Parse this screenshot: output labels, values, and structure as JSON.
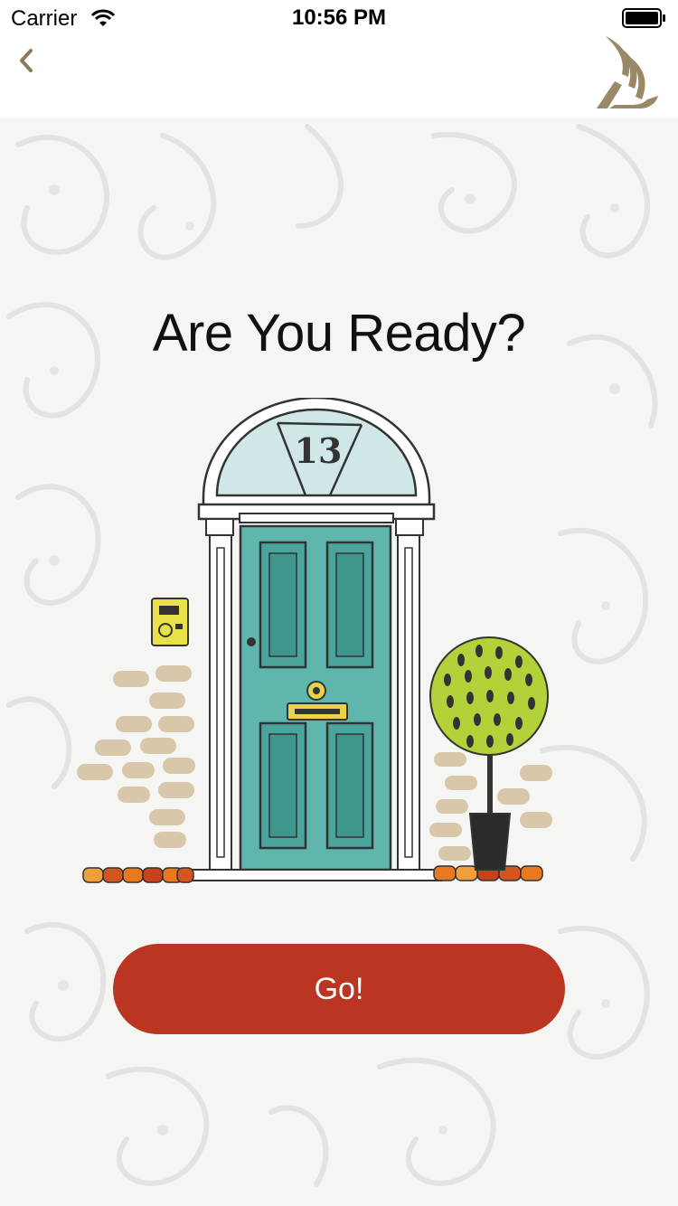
{
  "status_bar": {
    "carrier": "Carrier",
    "time": "10:56 PM"
  },
  "nav": {
    "back_icon": "chevron-left-icon",
    "logo_icon": "bird-logo-icon"
  },
  "main": {
    "title": "Are You Ready?",
    "door_number": "13",
    "go_label": "Go!"
  },
  "colors": {
    "accent": "#ba3522",
    "nav_icon": "#8c7a5f",
    "door": "#5fb6ad",
    "plant": "#b3d23a"
  }
}
